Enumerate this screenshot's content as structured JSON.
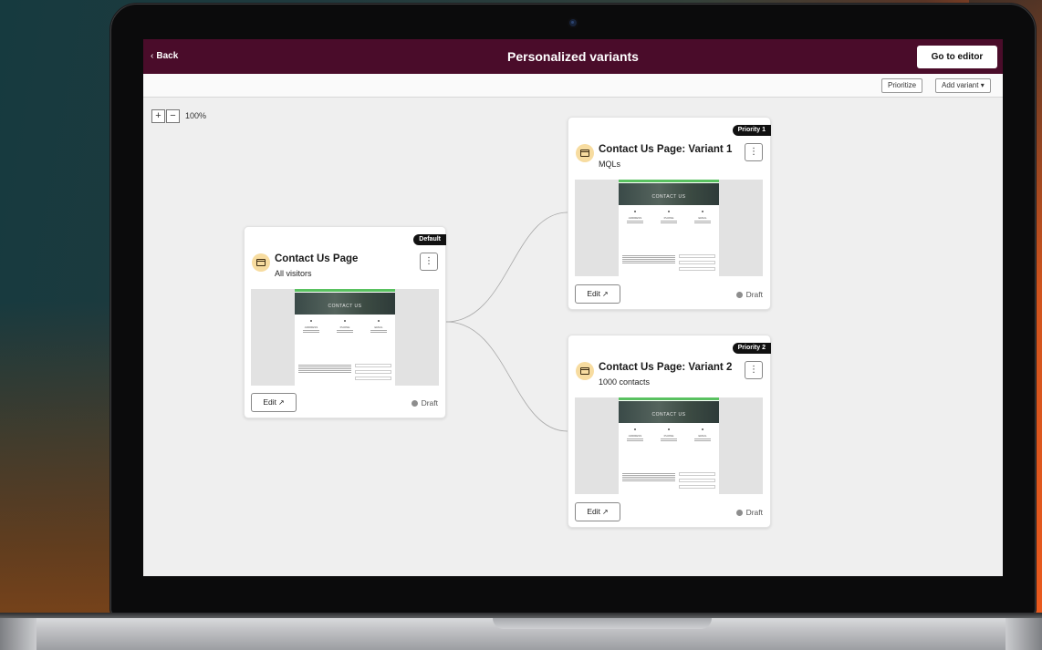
{
  "topbar": {
    "back_label": "Back",
    "title": "Personalized variants",
    "editor_button": "Go to editor"
  },
  "toolbar": {
    "prioritize": "Prioritize",
    "add_variant": "Add variant"
  },
  "zoom": {
    "plus": "+",
    "minus": "−",
    "level": "100%"
  },
  "cards": {
    "default": {
      "tag": "Default",
      "title": "Contact Us Page",
      "subtitle": "All visitors",
      "edit_label": "Edit",
      "status": "Draft"
    },
    "variant1": {
      "tag": "Priority 1",
      "title": "Contact Us Page: Variant 1",
      "subtitle": "MQLs",
      "edit_label": "Edit",
      "status": "Draft"
    },
    "variant2": {
      "tag": "Priority 2",
      "title": "Contact Us Page: Variant 2",
      "subtitle": "1000 contacts",
      "edit_label": "Edit",
      "status": "Draft"
    }
  },
  "preview": {
    "hero_text": "CONTACT US",
    "columns": [
      "ADDRESS",
      "PHONE",
      "EMAIL"
    ]
  },
  "icons": {
    "card": "page-icon",
    "more": "more-vertical-icon",
    "edit": "external-link-icon",
    "status": "status-dot-icon"
  },
  "colors": {
    "topbar": "#4a0c2a",
    "preview_accent": "#59c160",
    "icon_bg": "#f7dca0",
    "draft": "#8d8d8d"
  }
}
